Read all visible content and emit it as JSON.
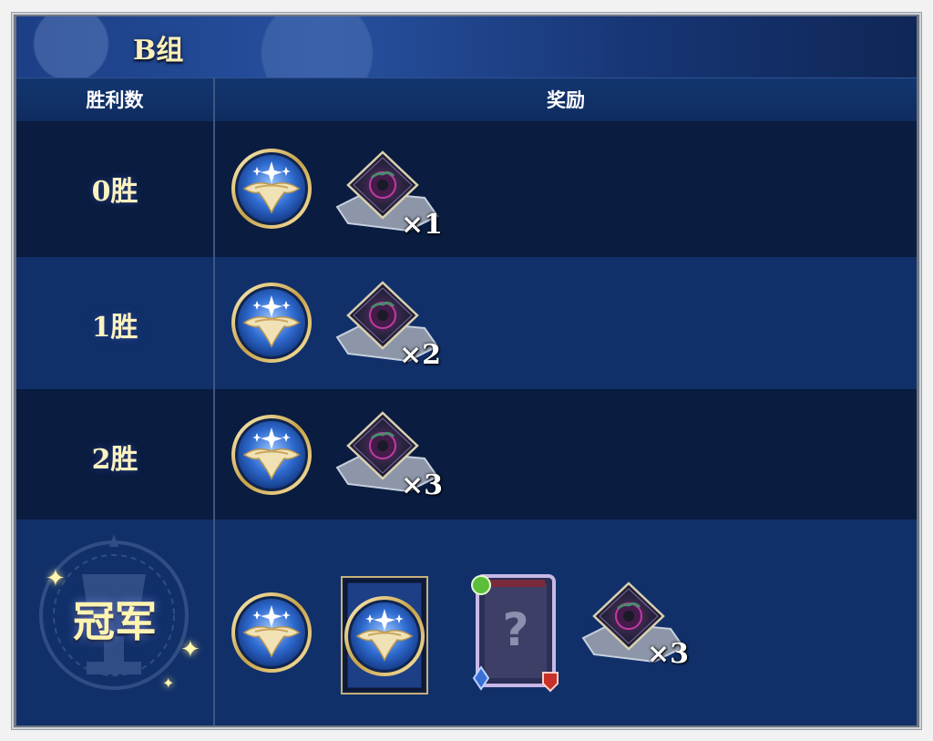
{
  "header": {
    "title": "B组"
  },
  "columns": {
    "wins": "胜利数",
    "rewards": "奖励"
  },
  "rows": [
    {
      "label": "0胜",
      "quantity": "×1"
    },
    {
      "label": "1胜",
      "quantity": "×2"
    },
    {
      "label": "2胜",
      "quantity": "×3"
    },
    {
      "label": "冠军",
      "quantity": "×3",
      "mystery_card_symbol": "?"
    }
  ],
  "icons": {
    "medal": "emblem-medal-icon",
    "crystal": "crystal-shard-icon",
    "card_back": "card-back-icon",
    "mystery_card": "mystery-card-icon"
  },
  "colors": {
    "panel": "#0b2048",
    "label_gold": "#fdf3bf",
    "header_blue": "#26509e"
  }
}
